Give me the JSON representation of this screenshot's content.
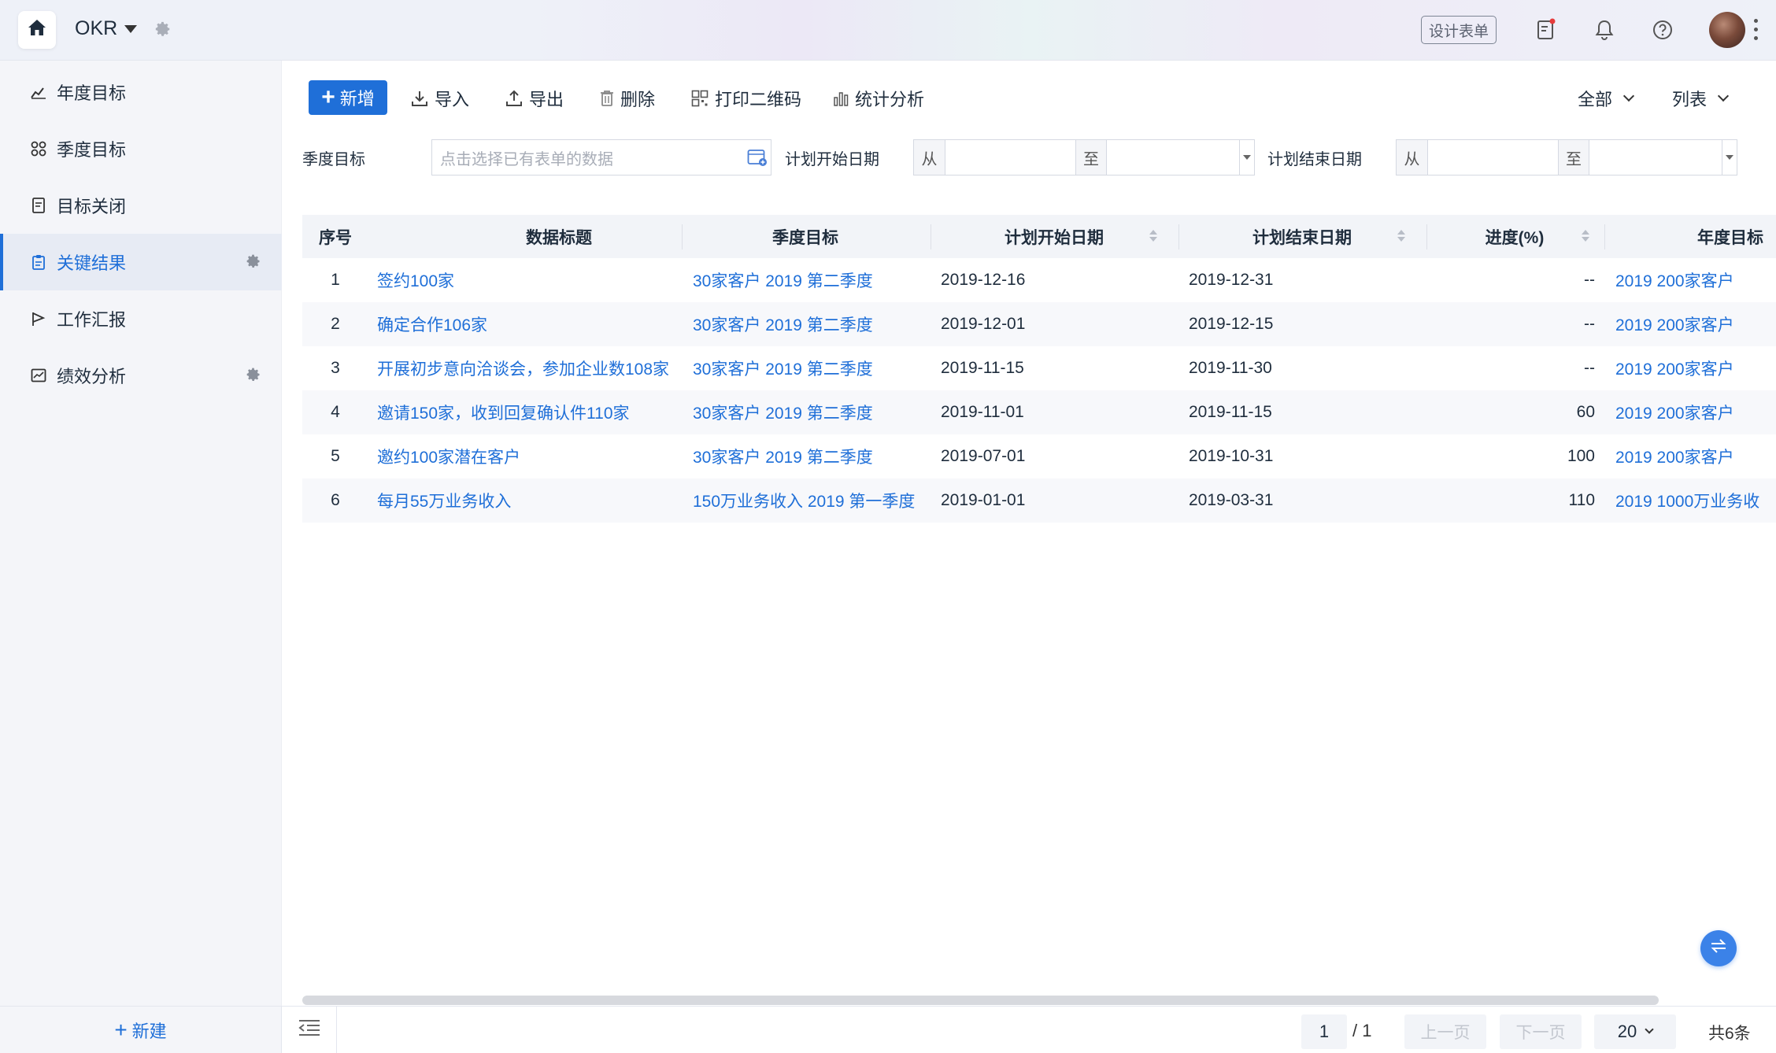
{
  "header": {
    "app_title": "OKR",
    "design_form_label": "设计表单"
  },
  "sidebar": {
    "items": [
      {
        "label": "年度目标",
        "icon": "line-chart-icon"
      },
      {
        "label": "季度目标",
        "icon": "grid-icon"
      },
      {
        "label": "目标关闭",
        "icon": "document-icon"
      },
      {
        "label": "关键结果",
        "icon": "clipboard-icon",
        "active": true
      },
      {
        "label": "工作汇报",
        "icon": "flag-icon"
      },
      {
        "label": "绩效分析",
        "icon": "chart-icon"
      }
    ],
    "new_label": "新建"
  },
  "toolbar": {
    "add_label": "新增",
    "import_label": "导入",
    "export_label": "导出",
    "delete_label": "删除",
    "print_qr_label": "打印二维码",
    "stats_label": "统计分析",
    "scope_label": "全部",
    "view_label": "列表"
  },
  "filters": {
    "quarter_goal_label": "季度目标",
    "quarter_goal_placeholder": "点击选择已有表单的数据",
    "plan_start_label": "计划开始日期",
    "plan_end_label": "计划结束日期",
    "from_label": "从",
    "to_label": "至"
  },
  "table": {
    "columns": [
      "序号",
      "数据标题",
      "季度目标",
      "计划开始日期",
      "计划结束日期",
      "进度(%)",
      "年度目标"
    ],
    "rows": [
      {
        "no": "1",
        "title": "签约100家",
        "quarter": "30家客户 2019 第二季度",
        "start": "2019-12-16",
        "end": "2019-12-31",
        "progress": "--",
        "annual": "2019 200家客户"
      },
      {
        "no": "2",
        "title": "确定合作106家",
        "quarter": "30家客户 2019 第二季度",
        "start": "2019-12-01",
        "end": "2019-12-15",
        "progress": "--",
        "annual": "2019 200家客户"
      },
      {
        "no": "3",
        "title": "开展初步意向洽谈会，参加企业数108家",
        "quarter": "30家客户 2019 第二季度",
        "start": "2019-11-15",
        "end": "2019-11-30",
        "progress": "--",
        "annual": "2019 200家客户"
      },
      {
        "no": "4",
        "title": "邀请150家，收到回复确认件110家",
        "quarter": "30家客户 2019 第二季度",
        "start": "2019-11-01",
        "end": "2019-11-15",
        "progress": "60",
        "annual": "2019 200家客户"
      },
      {
        "no": "5",
        "title": "邀约100家潜在客户",
        "quarter": "30家客户 2019 第二季度",
        "start": "2019-07-01",
        "end": "2019-10-31",
        "progress": "100",
        "annual": "2019 200家客户"
      },
      {
        "no": "6",
        "title": "每月55万业务收入",
        "quarter": "150万业务收入 2019 第一季度",
        "start": "2019-01-01",
        "end": "2019-03-31",
        "progress": "110",
        "annual": "2019 1000万业务收"
      }
    ]
  },
  "pagination": {
    "current_page": "1",
    "total_pages": "/ 1",
    "prev_label": "上一页",
    "next_label": "下一页",
    "page_size": "20",
    "total_count": "共6条"
  },
  "colors": {
    "accent": "#1f6fd8",
    "sidebar_bg": "#f4f5f9",
    "header_bg": "#f2f4f8",
    "link": "#1f6fd8"
  }
}
